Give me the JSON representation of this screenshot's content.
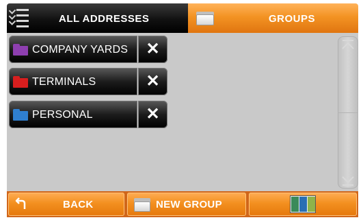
{
  "tabs": {
    "all_addresses_label": "ALL ADDRESSES",
    "groups_label": "GROUPS",
    "active": "GROUPS"
  },
  "groups": [
    {
      "label": "COMPANY YARDS",
      "folder_color": "#8e3fb0"
    },
    {
      "label": "TERMINALS",
      "folder_color": "#d81e1e"
    },
    {
      "label": "PERSONAL",
      "folder_color": "#2f7fd0"
    }
  ],
  "delete_glyph": "✕",
  "bottom": {
    "back_label": "BACK",
    "new_group_label": "NEW GROUP"
  },
  "colors": {
    "accent_orange": "#f39323",
    "tab_dark": "#111111",
    "panel_grey": "#c9c9c9"
  },
  "icons": [
    "list-checklist-icon",
    "folder-icon",
    "close-icon",
    "back-arrow-icon",
    "map-icon"
  ]
}
